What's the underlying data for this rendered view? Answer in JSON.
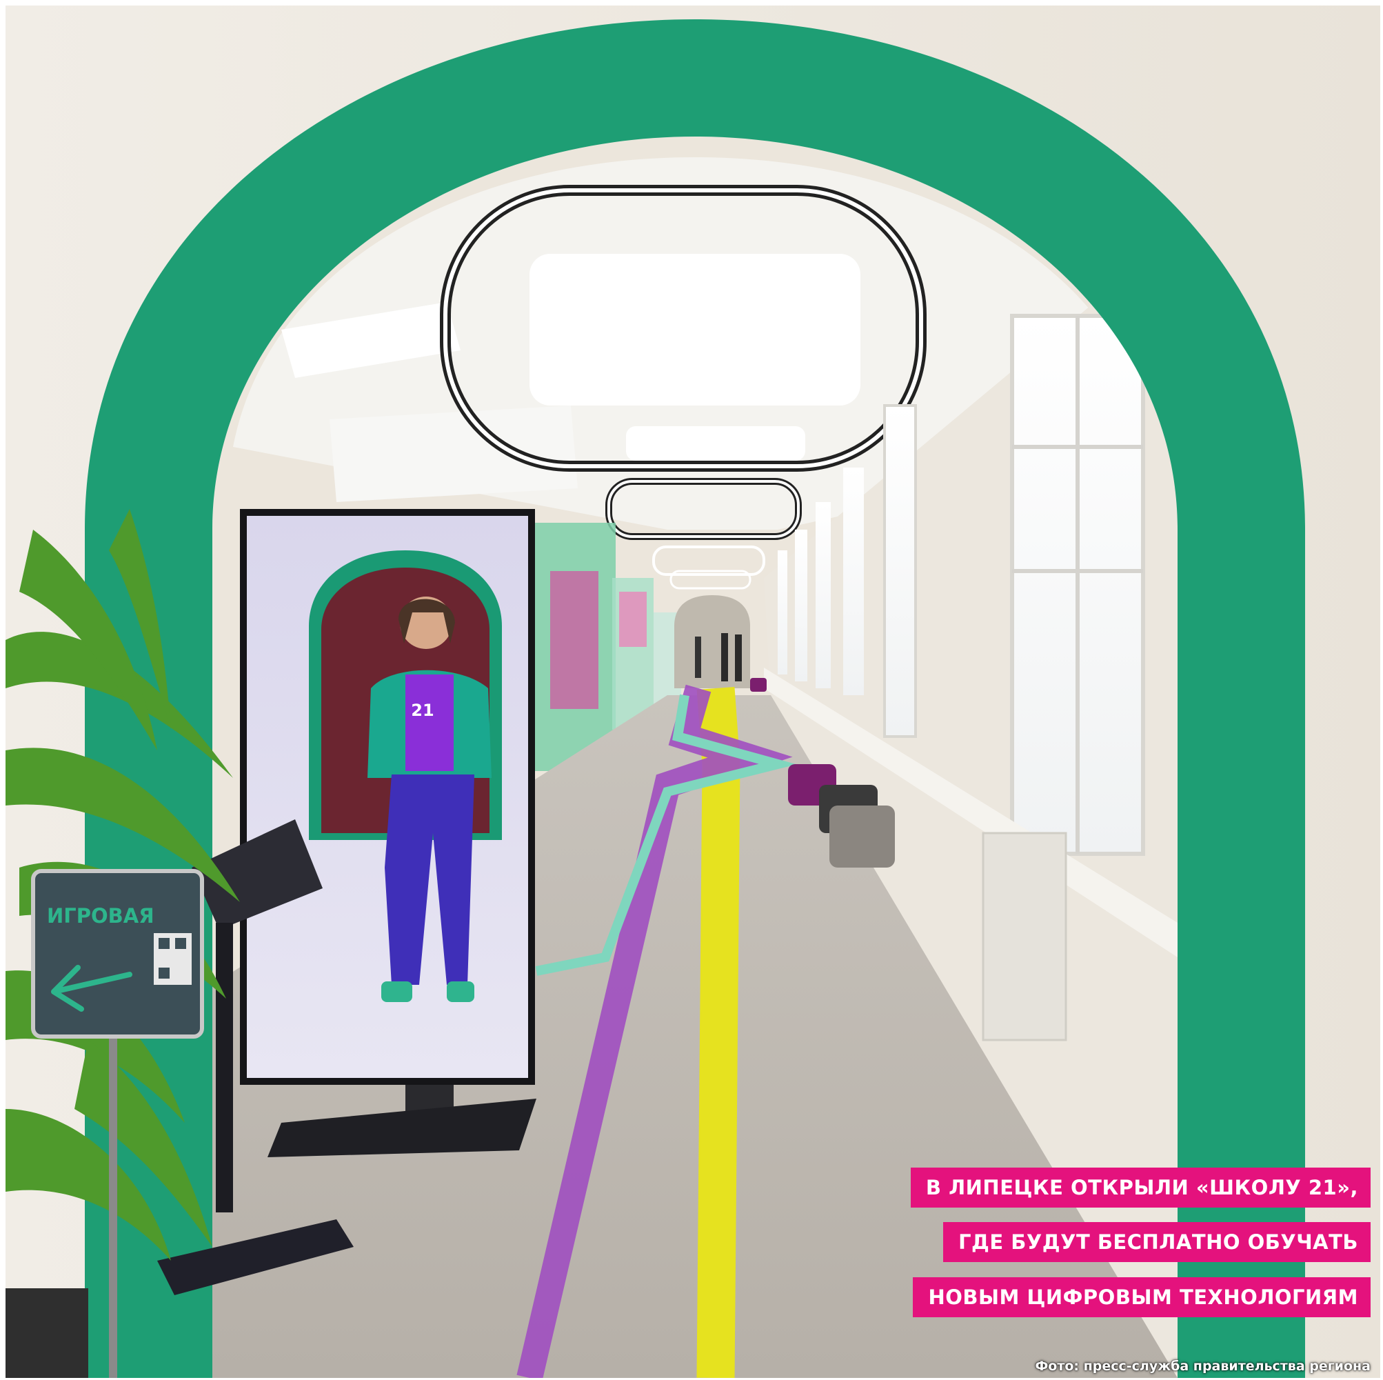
{
  "photo": {
    "headline": {
      "line1": "В ЛИПЕЦКЕ ОТКРЫЛИ «ШКОЛУ 21»,",
      "line2": "ГДЕ БУДУТ БЕСПЛАТНО ОБУЧАТЬ",
      "line3": "НОВЫМ ЦИФРОВЫМ ТЕХНОЛОГИЯМ"
    },
    "credit": "Фото: пресс-служба правительства региона",
    "sign_text": "ИГРОВАЯ",
    "screen_logo": "21",
    "colors": {
      "arch": "#1e9e74",
      "headline_bg": "#e4127d",
      "floor_yellow": "#e6e21f",
      "floor_purple": "#a04fc0",
      "floor_mint": "#7fd6be"
    }
  }
}
